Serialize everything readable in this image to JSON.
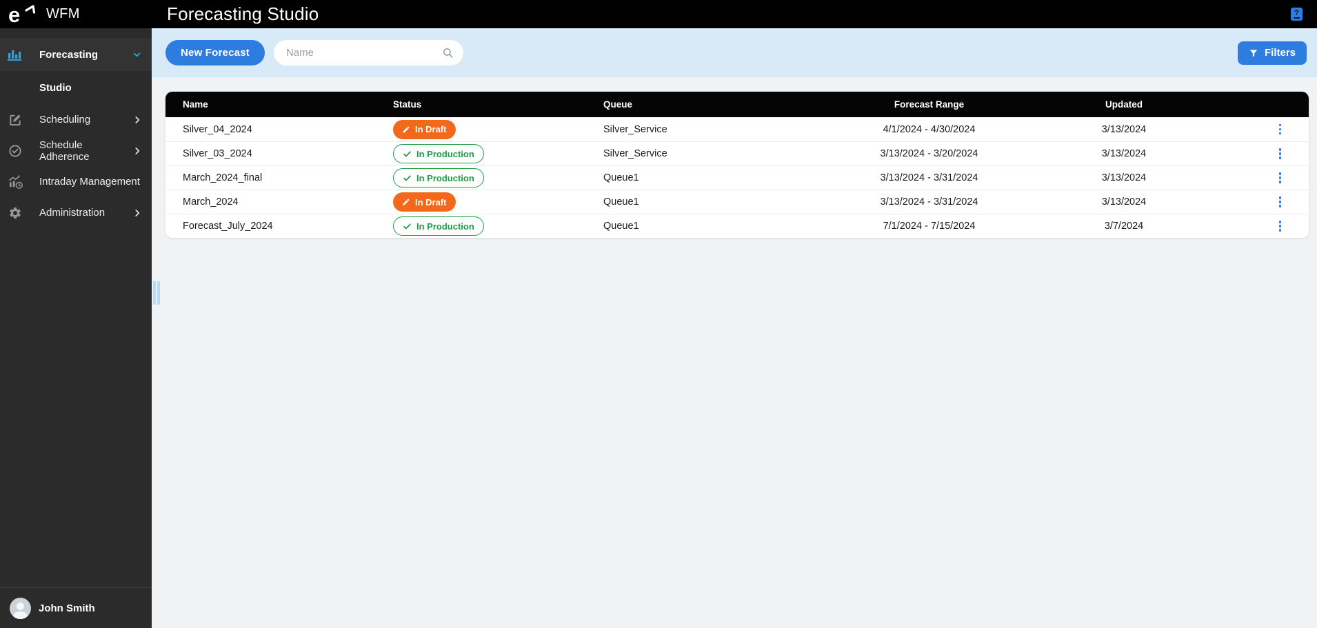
{
  "app": {
    "brand": "WFM",
    "title": "Forecasting Studio"
  },
  "topbar": {
    "help_label": "?"
  },
  "sidebar": {
    "items": [
      {
        "label": "Forecasting",
        "icon": "bar-chart-icon",
        "expanded": true,
        "children": [
          {
            "label": "Studio",
            "active": true
          }
        ]
      },
      {
        "label": "Scheduling",
        "icon": "edit-icon",
        "chevron": "right"
      },
      {
        "label": "Schedule Adherence",
        "icon": "check-circle-icon",
        "chevron": "right"
      },
      {
        "label": "Intraday Management",
        "icon": "intraday-chart-icon",
        "chevron": "none"
      },
      {
        "label": "Administration",
        "icon": "gear-icon",
        "chevron": "right"
      }
    ],
    "user": {
      "name": "John Smith"
    }
  },
  "toolbar": {
    "new_forecast_label": "New Forecast",
    "search_placeholder": "Name",
    "search_value": "",
    "filters_label": "Filters"
  },
  "table": {
    "columns": [
      "Name",
      "Status",
      "Queue",
      "Forecast Range",
      "Updated"
    ],
    "rows": [
      {
        "name": "Silver_04_2024",
        "status": "In Draft",
        "status_type": "draft",
        "queue": "Silver_Service",
        "forecast_range": "4/1/2024 - 4/30/2024",
        "updated": "3/13/2024"
      },
      {
        "name": "Silver_03_2024",
        "status": "In Production",
        "status_type": "production",
        "queue": "Silver_Service",
        "forecast_range": "3/13/2024 - 3/20/2024",
        "updated": "3/13/2024"
      },
      {
        "name": "March_2024_final",
        "status": "In Production",
        "status_type": "production",
        "queue": "Queue1",
        "forecast_range": "3/13/2024 - 3/31/2024",
        "updated": "3/13/2024"
      },
      {
        "name": "March_2024",
        "status": "In Draft",
        "status_type": "draft",
        "queue": "Queue1",
        "forecast_range": "3/13/2024 - 3/31/2024",
        "updated": "3/13/2024"
      },
      {
        "name": "Forecast_July_2024",
        "status": "In Production",
        "status_type": "production",
        "queue": "Queue1",
        "forecast_range": "7/1/2024 - 7/15/2024",
        "updated": "3/7/2024"
      }
    ]
  },
  "colors": {
    "topbar_bg": "#000000",
    "sidebar_bg": "#2b2b2b",
    "accent_blue": "#2e7ce0",
    "sidebar_icon_blue": "#2da4e0",
    "toolbar_band": "#d8e9f8",
    "draft_orange": "#f2691c",
    "production_green": "#1f9c45",
    "table_header_bg": "#050505"
  }
}
